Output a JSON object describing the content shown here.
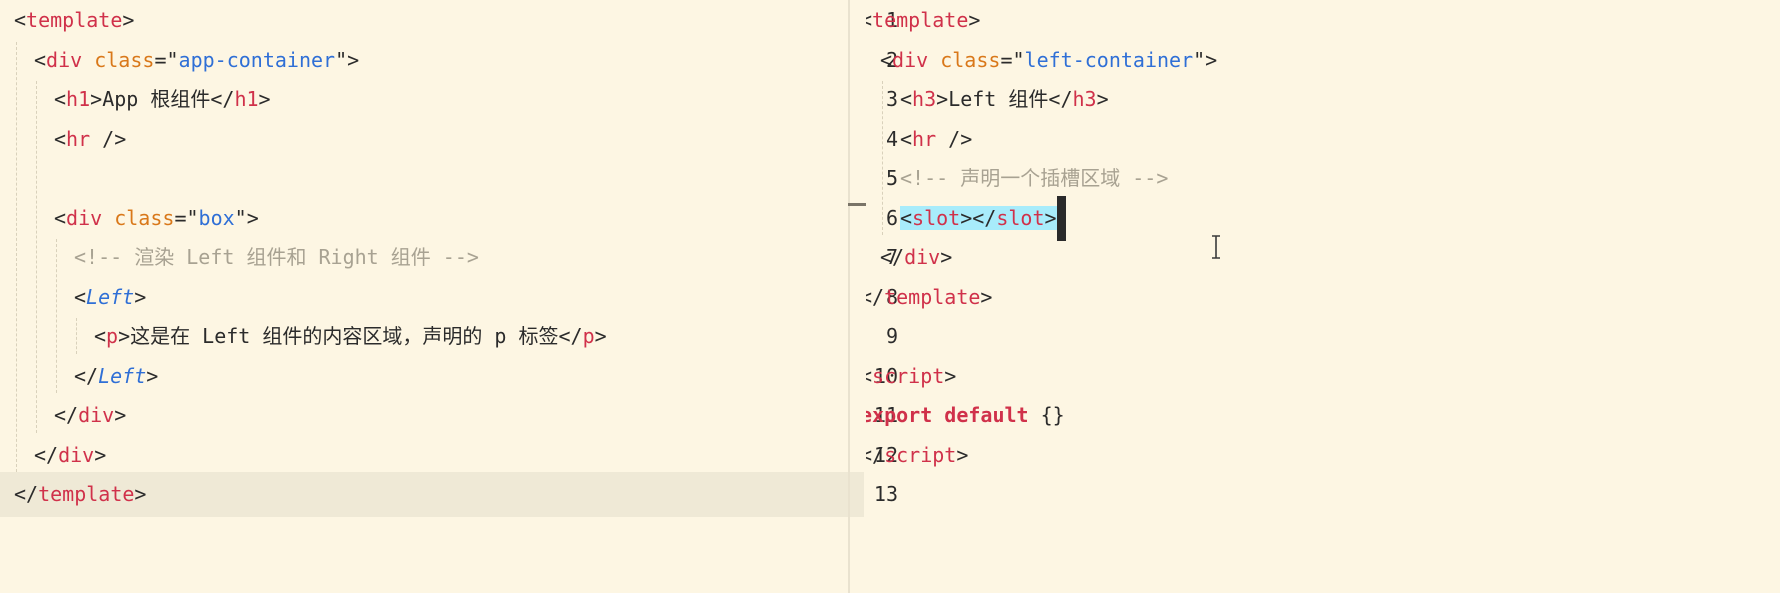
{
  "left_editor": {
    "lines": [
      {
        "tokens": [
          {
            "t": "<",
            "c": "p"
          },
          {
            "t": "template",
            "c": "tag"
          },
          {
            "t": ">",
            "c": "p"
          }
        ]
      },
      {
        "tokens": [
          {
            "t": "<",
            "c": "p"
          },
          {
            "t": "div",
            "c": "tag"
          },
          {
            "t": " ",
            "c": "p"
          },
          {
            "t": "class",
            "c": "attr"
          },
          {
            "t": "=\"",
            "c": "p"
          },
          {
            "t": "app-container",
            "c": "str"
          },
          {
            "t": "\">",
            "c": "p"
          }
        ]
      },
      {
        "tokens": [
          {
            "t": "<",
            "c": "p"
          },
          {
            "t": "h1",
            "c": "tag"
          },
          {
            "t": ">",
            "c": "p"
          },
          {
            "t": "App 根组件",
            "c": "txt"
          },
          {
            "t": "</",
            "c": "p"
          },
          {
            "t": "h1",
            "c": "tag"
          },
          {
            "t": ">",
            "c": "p"
          }
        ]
      },
      {
        "tokens": [
          {
            "t": "<",
            "c": "p"
          },
          {
            "t": "hr",
            "c": "tag"
          },
          {
            "t": " />",
            "c": "p"
          }
        ]
      },
      {
        "tokens": []
      },
      {
        "tokens": [
          {
            "t": "<",
            "c": "p"
          },
          {
            "t": "div",
            "c": "tag"
          },
          {
            "t": " ",
            "c": "p"
          },
          {
            "t": "class",
            "c": "attr"
          },
          {
            "t": "=\"",
            "c": "p"
          },
          {
            "t": "box",
            "c": "str"
          },
          {
            "t": "\">",
            "c": "p"
          }
        ]
      },
      {
        "tokens": [
          {
            "t": "<!-- 渲染 Left 组件和 Right 组件 -->",
            "c": "cmt"
          }
        ]
      },
      {
        "tokens": [
          {
            "t": "<",
            "c": "p"
          },
          {
            "t": "Left",
            "c": "comp"
          },
          {
            "t": ">",
            "c": "p"
          }
        ]
      },
      {
        "tokens": [
          {
            "t": "<",
            "c": "p"
          },
          {
            "t": "p",
            "c": "tag"
          },
          {
            "t": ">",
            "c": "p"
          },
          {
            "t": "这是在 Left 组件的内容区域，声明的 p 标签",
            "c": "txt"
          },
          {
            "t": "</",
            "c": "p"
          },
          {
            "t": "p",
            "c": "tag"
          },
          {
            "t": ">",
            "c": "p"
          }
        ]
      },
      {
        "tokens": [
          {
            "t": "</",
            "c": "p"
          },
          {
            "t": "Left",
            "c": "comp"
          },
          {
            "t": ">",
            "c": "p"
          }
        ]
      },
      {
        "tokens": [
          {
            "t": "</",
            "c": "p"
          },
          {
            "t": "div",
            "c": "tag"
          },
          {
            "t": ">",
            "c": "p"
          }
        ]
      },
      {
        "tokens": [
          {
            "t": "</",
            "c": "p"
          },
          {
            "t": "div",
            "c": "tag"
          },
          {
            "t": ">",
            "c": "p"
          }
        ]
      },
      {
        "tokens": [
          {
            "t": "</",
            "c": "p"
          },
          {
            "t": "template",
            "c": "tag"
          },
          {
            "t": ">",
            "c": "p"
          }
        ]
      }
    ]
  },
  "right_editor": {
    "line_numbers": [
      "1",
      "2",
      "3",
      "4",
      "5",
      "6",
      "7",
      "8",
      "9",
      "10",
      "11",
      "12",
      "13"
    ],
    "lines": [
      {
        "tokens": [
          {
            "t": "<",
            "c": "p"
          },
          {
            "t": "template",
            "c": "tag"
          },
          {
            "t": ">",
            "c": "p"
          }
        ]
      },
      {
        "tokens": [
          {
            "t": "<",
            "c": "p"
          },
          {
            "t": "div",
            "c": "tag"
          },
          {
            "t": " ",
            "c": "p"
          },
          {
            "t": "class",
            "c": "attr"
          },
          {
            "t": "=\"",
            "c": "p"
          },
          {
            "t": "left-container",
            "c": "str"
          },
          {
            "t": "\">",
            "c": "p"
          }
        ]
      },
      {
        "tokens": [
          {
            "t": "<",
            "c": "p"
          },
          {
            "t": "h3",
            "c": "tag"
          },
          {
            "t": ">",
            "c": "p"
          },
          {
            "t": "Left 组件",
            "c": "txt"
          },
          {
            "t": "</",
            "c": "p"
          },
          {
            "t": "h3",
            "c": "tag"
          },
          {
            "t": ">",
            "c": "p"
          }
        ]
      },
      {
        "tokens": [
          {
            "t": "<",
            "c": "p"
          },
          {
            "t": "hr",
            "c": "tag"
          },
          {
            "t": " />",
            "c": "p"
          }
        ]
      },
      {
        "tokens": [
          {
            "t": "<!-- 声明一个插槽区域 -->",
            "c": "cmt"
          }
        ]
      },
      {
        "tokens": [
          {
            "t": "<",
            "c": "p",
            "sel": true
          },
          {
            "t": "slot",
            "c": "tag",
            "sel": true
          },
          {
            "t": "></",
            "c": "p",
            "sel": true
          },
          {
            "t": "slot",
            "c": "tag",
            "sel": true
          },
          {
            "t": ">",
            "c": "p",
            "sel": true
          }
        ]
      },
      {
        "tokens": [
          {
            "t": "</",
            "c": "p"
          },
          {
            "t": "div",
            "c": "tag"
          },
          {
            "t": ">",
            "c": "p"
          }
        ]
      },
      {
        "tokens": [
          {
            "t": "</",
            "c": "p"
          },
          {
            "t": "template",
            "c": "tag"
          },
          {
            "t": ">",
            "c": "p"
          }
        ]
      },
      {
        "tokens": []
      },
      {
        "tokens": [
          {
            "t": "<",
            "c": "p"
          },
          {
            "t": "script",
            "c": "tag"
          },
          {
            "t": ">",
            "c": "p"
          }
        ]
      },
      {
        "tokens": [
          {
            "t": "export",
            "c": "kw"
          },
          {
            "t": " ",
            "c": "p"
          },
          {
            "t": "default",
            "c": "kw"
          },
          {
            "t": " {}",
            "c": "p"
          }
        ]
      },
      {
        "tokens": [
          {
            "t": "</",
            "c": "p"
          },
          {
            "t": "script",
            "c": "tag"
          },
          {
            "t": ">",
            "c": "p"
          }
        ]
      },
      {
        "tokens": []
      }
    ]
  },
  "colors": {
    "background": "#fdf6e3",
    "tag": "#d0314a",
    "attribute": "#d9781a",
    "string": "#2f6fd6",
    "comment": "#a8a292",
    "selection": "#a8ecfb",
    "current_line": "#efe9d6"
  },
  "cursor_icon": "i-beam-cursor-icon"
}
